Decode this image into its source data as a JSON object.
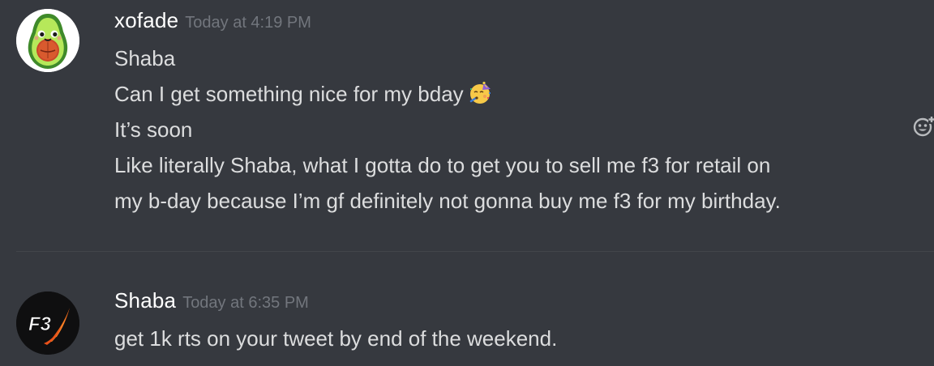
{
  "messages": [
    {
      "username": "xofade",
      "timestamp": "Today at 4:19 PM",
      "lines": [
        "Shaba",
        "Can I get something nice for my bday",
        "It’s soon",
        "Like literally Shaba, what I gotta do to get you to sell me f3 for retail on",
        "my b-day because I’m gf definitely not gonna buy me f3 for my birthday."
      ],
      "emoji": "partying-face-emoji",
      "avatar_icon": "avocado-avatar-icon"
    },
    {
      "username": "Shaba",
      "timestamp": "Today at 6:35 PM",
      "lines": [
        "get 1k rts on your tweet by end of the weekend."
      ],
      "avatar_icon": "f3-logo-avatar-icon",
      "avatar_text": "F3"
    }
  ],
  "actions": {
    "add_reaction_icon": "add-reaction-icon"
  },
  "colors": {
    "background": "#36393f",
    "username": "#ffffff",
    "timestamp": "#72767d",
    "message_text": "#dcddde",
    "divider": "#42454a",
    "f3_accent": "#f26a1b"
  }
}
